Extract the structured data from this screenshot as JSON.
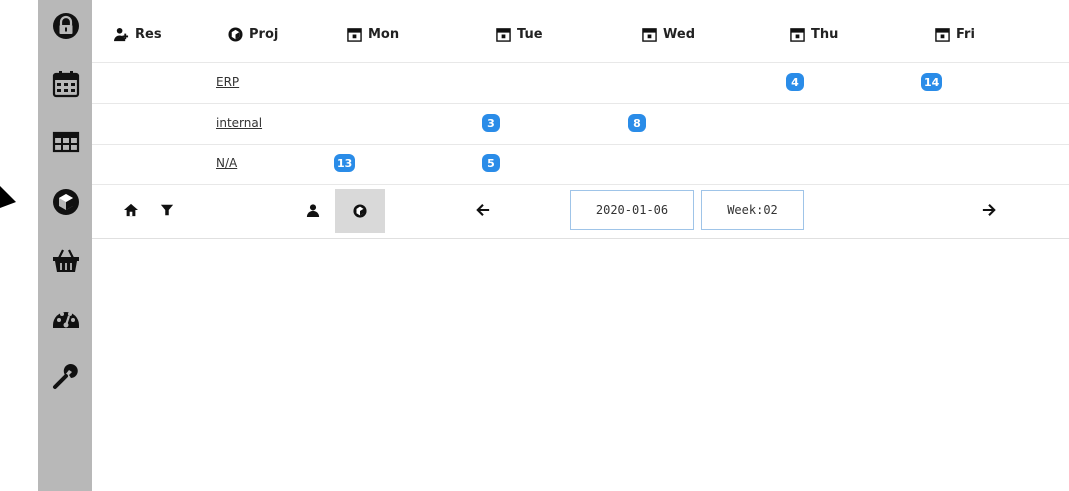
{
  "header": {
    "res_label": "Res",
    "proj_label": "Proj",
    "days": [
      "Mon",
      "Tue",
      "Wed",
      "Thu",
      "Fri"
    ]
  },
  "rows": [
    {
      "project": "ERP",
      "badges": {
        "thu": "4",
        "fri": "14"
      }
    },
    {
      "project": "internal",
      "badges": {
        "tue": "3",
        "wed": "8"
      }
    },
    {
      "project": "N/A",
      "badges": {
        "mon": "13",
        "tue": "5"
      }
    }
  ],
  "toolbar": {
    "date_value": "2020-01-06",
    "week_value": "Week:02"
  },
  "colors": {
    "sidebar_bg": "#b8b8b8",
    "badge_bg": "#2a8ce8",
    "toolbar_active_bg": "#d9d9d9",
    "input_border": "#9fc4e8"
  },
  "icons": {
    "sidebar": [
      "lock-icon",
      "calendar-icon",
      "table-icon",
      "cube-icon",
      "basket-icon",
      "dashboard-icon",
      "wrench-icon"
    ],
    "toolbar": [
      "home-icon",
      "filter-icon",
      "user-icon",
      "cube-icon",
      "arrow-left-icon",
      "arrow-right-icon"
    ]
  }
}
